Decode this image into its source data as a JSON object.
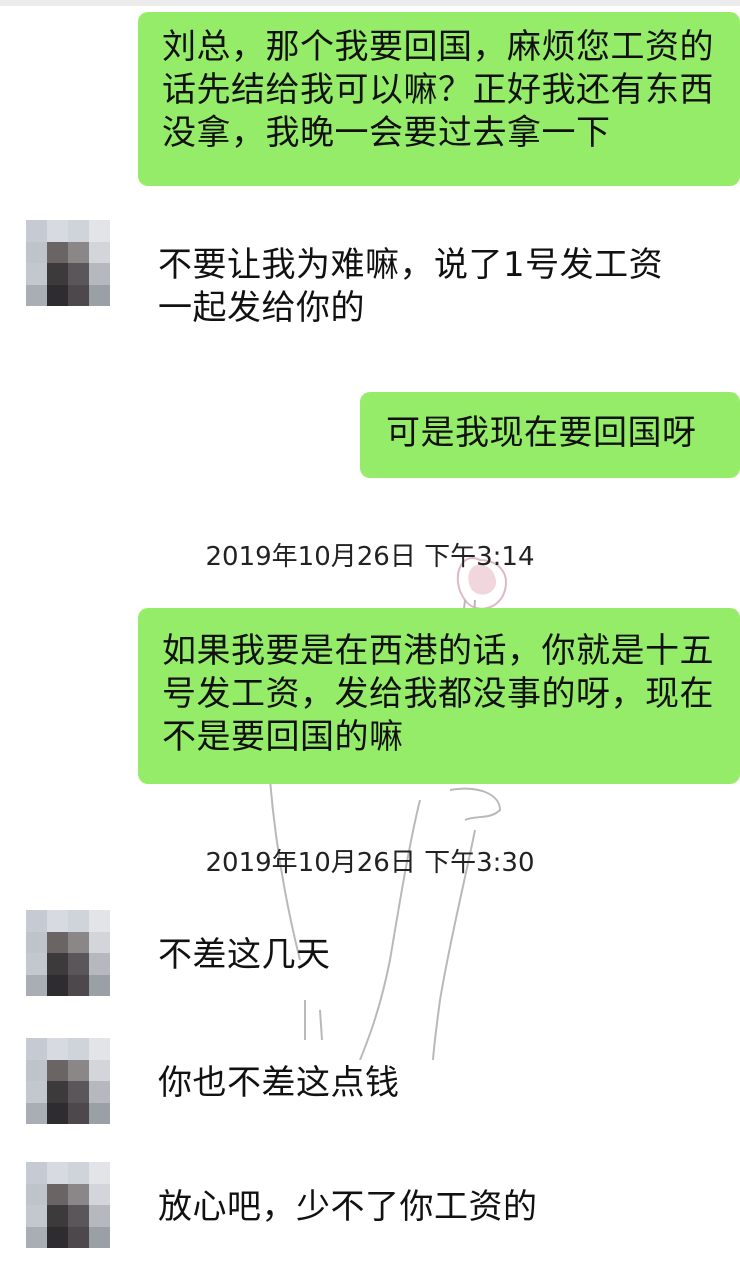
{
  "chat": {
    "messages": [
      {
        "side": "right",
        "text": "刘总，那个我要回国，麻烦您工资的话先结给我可以嘛？正好我还有东西没拿，我晚一会要过去拿一下"
      },
      {
        "side": "left",
        "text": "不要让我为难嘛，说了1号发工资一起发给你的"
      },
      {
        "side": "right",
        "text": "可是我现在要回国呀"
      },
      {
        "side": "right",
        "text": "如果我要是在西港的话，你就是十五号发工资，发给我都没事的呀，现在不是要回国的嘛"
      },
      {
        "side": "left",
        "text": "不差这几天"
      },
      {
        "side": "left",
        "text": "你也不差这点钱"
      },
      {
        "side": "left",
        "text": "放心吧，少不了你工资的"
      }
    ],
    "timestamps": [
      "2019年10月26日 下午3:14",
      "2019年10月26日 下午3:30"
    ]
  },
  "colors": {
    "outgoing_bubble": "#95ec69",
    "background": "#ffffff"
  },
  "icons": {
    "avatar": "pixelated-avatar-icon",
    "background_art": "rose-hand-sketch"
  }
}
